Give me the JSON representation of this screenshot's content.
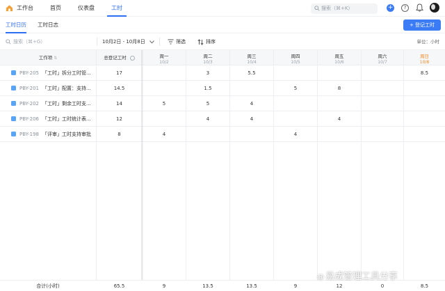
{
  "topnav": {
    "items": [
      {
        "label": "工作台"
      },
      {
        "label": "首页"
      },
      {
        "label": "仪表盘"
      },
      {
        "label": "工时",
        "active": true
      }
    ],
    "search_placeholder": "搜索（⌘+K）"
  },
  "subtabs": [
    {
      "label": "工时日历",
      "active": true
    },
    {
      "label": "工时日志"
    }
  ],
  "register_button": "+ 登记工时",
  "filters": {
    "search_placeholder": "搜索（⌘+G）",
    "date_range": "10月2日 - 10月8日",
    "filter_label": "筛选",
    "sort_label": "排序",
    "unit": "单位：小时"
  },
  "table": {
    "col_task": "工作项",
    "col_total": "总登记工时",
    "days": [
      {
        "day": "周一",
        "date": "10/2"
      },
      {
        "day": "周二",
        "date": "10/3"
      },
      {
        "day": "周三",
        "date": "10/4"
      },
      {
        "day": "周四",
        "date": "10/5"
      },
      {
        "day": "周五",
        "date": "10/6"
      },
      {
        "day": "周六",
        "date": "10/7"
      },
      {
        "day": "周日",
        "date": "10/8",
        "today": true
      }
    ],
    "rows": [
      {
        "id": "PBY-205",
        "name": "「工时」拆分工时管...",
        "total": "17",
        "cells": [
          "",
          "3",
          "5.5",
          "",
          "",
          "",
          "8.5"
        ]
      },
      {
        "id": "PBY-201",
        "name": "「工时」配置：支持...",
        "total": "14.5",
        "cells": [
          "",
          "1.5",
          "",
          "5",
          "8",
          "",
          ""
        ]
      },
      {
        "id": "PBY-202",
        "name": "「工时」剩余工时支...",
        "total": "14",
        "cells": [
          "5",
          "5",
          "4",
          "",
          "",
          "",
          ""
        ]
      },
      {
        "id": "PBY-206",
        "name": "「工时」工时统计表...",
        "total": "12",
        "cells": [
          "",
          "4",
          "4",
          "",
          "4",
          "",
          ""
        ]
      },
      {
        "id": "PBY-198",
        "name": "「评审」工时支持审批",
        "total": "8",
        "cells": [
          "4",
          "",
          "",
          "4",
          "",
          "",
          ""
        ]
      }
    ],
    "footer": {
      "label": "合计(小时)",
      "total": "65.5",
      "cells": [
        "9",
        "13.5",
        "13.5",
        "9",
        "12",
        "0",
        "8.5"
      ]
    }
  },
  "watermark": {
    "at": "@",
    "text": "易成管理工具分享"
  },
  "colors": {
    "accent": "#2f6ff5",
    "today": "#f08a24",
    "type_icon": "#5aa4f7"
  }
}
